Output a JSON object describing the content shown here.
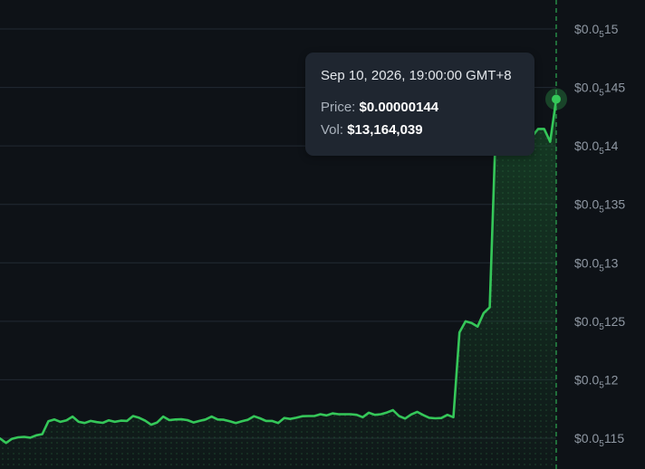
{
  "chart_data": {
    "type": "area",
    "series": [
      {
        "values": [
          1.1498e-06,
          1.146e-06,
          1.1495e-06,
          1.1508e-06,
          1.1512e-06,
          1.1505e-06,
          1.1525e-06,
          1.1535e-06,
          1.1645e-06,
          1.166e-06,
          1.164e-06,
          1.1653e-06,
          1.1685e-06,
          1.164e-06,
          1.163e-06,
          1.1648e-06,
          1.1638e-06,
          1.1632e-06,
          1.1653e-06,
          1.164e-06,
          1.165e-06,
          1.1648e-06,
          1.169e-06,
          1.1675e-06,
          1.165e-06,
          1.1615e-06,
          1.1635e-06,
          1.1685e-06,
          1.1655e-06,
          1.166e-06,
          1.1662e-06,
          1.1655e-06,
          1.1635e-06,
          1.1648e-06,
          1.166e-06,
          1.1685e-06,
          1.166e-06,
          1.1658e-06,
          1.1645e-06,
          1.163e-06,
          1.1645e-06,
          1.1658e-06,
          1.1688e-06,
          1.167e-06,
          1.1648e-06,
          1.1648e-06,
          1.163e-06,
          1.1673e-06,
          1.1665e-06,
          1.1675e-06,
          1.1688e-06,
          1.169e-06,
          1.169e-06,
          1.1705e-06,
          1.1695e-06,
          1.1712e-06,
          1.1705e-06,
          1.1705e-06,
          1.1705e-06,
          1.17e-06,
          1.168e-06,
          1.1718e-06,
          1.17e-06,
          1.1705e-06,
          1.172e-06,
          1.174e-06,
          1.169e-06,
          1.1668e-06,
          1.1703e-06,
          1.1725e-06,
          1.1698e-06,
          1.1675e-06,
          1.167e-06,
          1.1673e-06,
          1.17e-06,
          1.168e-06,
          1.2405e-06,
          1.25e-06,
          1.2485e-06,
          1.2455e-06,
          1.257e-06,
          1.262e-06,
          1.417e-06,
          1.4085e-06,
          1.4135e-06,
          1.417e-06,
          1.414e-06,
          1.4145e-06,
          1.408e-06,
          1.4145e-06,
          1.4145e-06,
          1.4035e-06,
          1.44e-06
        ]
      }
    ],
    "y_ticks": [
      {
        "prefix": "$0.0",
        "sub": "5",
        "digits": "15",
        "value": 1.5e-06
      },
      {
        "prefix": "$0.0",
        "sub": "5",
        "digits": "145",
        "value": 1.45e-06
      },
      {
        "prefix": "$0.0",
        "sub": "5",
        "digits": "14",
        "value": 1.4e-06
      },
      {
        "prefix": "$0.0",
        "sub": "5",
        "digits": "135",
        "value": 1.35e-06
      },
      {
        "prefix": "$0.0",
        "sub": "5",
        "digits": "13",
        "value": 1.3e-06
      },
      {
        "prefix": "$0.0",
        "sub": "5",
        "digits": "125",
        "value": 1.25e-06
      },
      {
        "prefix": "$0.0",
        "sub": "5",
        "digits": "12",
        "value": 1.2e-06
      },
      {
        "prefix": "$0.0",
        "sub": "5",
        "digits": "115",
        "value": 1.15e-06
      }
    ],
    "ylim": [
      1.125e-06,
      1.5e-06
    ],
    "grid": true,
    "line_color": "#35c759",
    "area_color": "#1b5c2e",
    "background_color": "#0e1217",
    "crosshair_color": "#2da851",
    "tooltip": {
      "time": "Sep 10, 2026, 19:00:00 GMT+8",
      "price_label": "Price:",
      "price_value": "$0.00000144",
      "vol_label": "Vol:",
      "vol_value": "$13,164,039"
    }
  }
}
